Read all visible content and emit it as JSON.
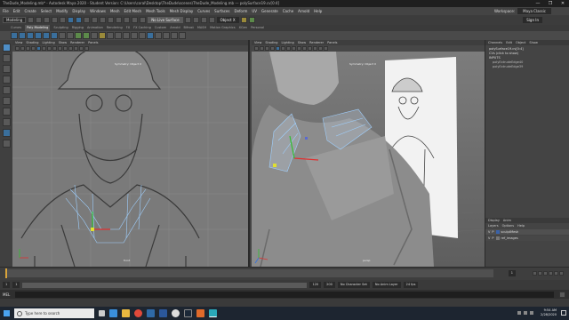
{
  "titlebar": {
    "text": "TheDude_Modeling.mb* - Autodesk Maya 2020 - Student Version: C:\\Users\\coral\\Desktop\\TheDude\\scenes\\TheDude_Modeling.mb --- polySurface19.cv[0:4]",
    "minimize": "—",
    "maximize": "❐",
    "close": "✕"
  },
  "menubar": {
    "items": [
      "File",
      "Edit",
      "Create",
      "Select",
      "Modify",
      "Display",
      "Windows",
      "Mesh",
      "Edit Mesh",
      "Mesh Tools",
      "Mesh Display",
      "Curves",
      "Surfaces",
      "Deform",
      "UV",
      "Generate",
      "Cache",
      "Arnold",
      "Help"
    ],
    "workspace_label": "Workspace:",
    "workspace_value": "Maya Classic"
  },
  "statusline": {
    "mode": "Modeling",
    "live_surface": "No Live Surface",
    "symmetry": "Object X",
    "sign_in": "Sign In"
  },
  "shelf": {
    "tabs": [
      "Curves",
      "Poly Modeling",
      "Sculpting",
      "Rigging",
      "Animation",
      "Rendering",
      "FX",
      "FX Caching",
      "Custom",
      "Arnold",
      "Bifrost",
      "MASH",
      "Motion Graphics",
      "XGen",
      "Personal"
    ],
    "active_tab": "Poly Modeling"
  },
  "viewport_left": {
    "menu": [
      "View",
      "Shading",
      "Lighting",
      "Show",
      "Renderer",
      "Panels"
    ],
    "symmetry_label": "Symmetry: Object X",
    "camera_label": "front"
  },
  "viewport_right": {
    "menu": [
      "View",
      "Shading",
      "Lighting",
      "Show",
      "Renderer",
      "Panels"
    ],
    "symmetry_label": "Symmetry: Object X",
    "camera_label": "persp"
  },
  "channel_box": {
    "tabs": [
      "Channels",
      "Edit",
      "Object",
      "Show"
    ],
    "lines": [
      {
        "text": "polySurface19.cv[0:4]",
        "indent": false
      },
      {
        "text": "CVs (click to show)",
        "indent": false
      },
      {
        "text": "INPUTS",
        "indent": false
      },
      {
        "text": "polyExtrudeEdge40",
        "indent": true
      },
      {
        "text": "polyExtrudeEdge39",
        "indent": true
      }
    ]
  },
  "layer_editor": {
    "tabs": [
      "Display",
      "Anim"
    ],
    "menu": [
      "Layers",
      "Options",
      "Help"
    ],
    "layers": [
      {
        "v": "V",
        "p": "P",
        "name": "sculptMesh",
        "color": "#3a62a8"
      },
      {
        "v": "V",
        "p": "P",
        "name": "ref_images",
        "color": "#777777"
      }
    ]
  },
  "timeline": {
    "start": "1",
    "end": "120",
    "current": "1"
  },
  "range_slider": {
    "start": "1",
    "range_start": "1",
    "range_end": "120",
    "end": "200",
    "character_set": "No Character Set",
    "anim_layer": "No Anim Layer",
    "fps": "24 fps"
  },
  "command_line": {
    "language": "MEL"
  },
  "taskbar": {
    "search_placeholder": "Type here to search",
    "time": "9:54 AM",
    "date": "2/28/2020",
    "apps": [
      {
        "name": "task-view",
        "color": "#cccccc"
      },
      {
        "name": "edge",
        "color": "#3a8fdc"
      },
      {
        "name": "file-explorer",
        "color": "#e8b840"
      },
      {
        "name": "chrome",
        "color": "#e0493a"
      },
      {
        "name": "photoshop",
        "color": "#2f6aa8"
      },
      {
        "name": "word",
        "color": "#2b579a"
      },
      {
        "name": "unreal",
        "color": "#dddddd"
      },
      {
        "name": "steam",
        "color": "#1b2838"
      },
      {
        "name": "substance",
        "color": "#e06a2a"
      },
      {
        "name": "maya",
        "color": "#2aa8b8"
      }
    ]
  },
  "colors": {
    "ui_bg": "#444444",
    "viewport_bg": "#6e6e6e",
    "selection_blue": "#4e8ec7",
    "timeline_cursor": "#d9a43b",
    "taskbar": "#1d2530"
  }
}
